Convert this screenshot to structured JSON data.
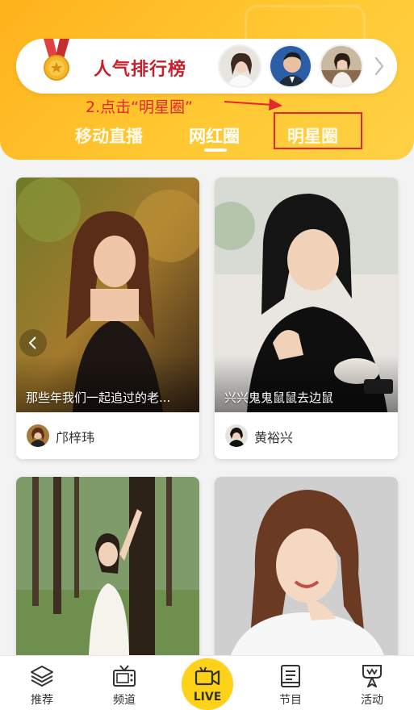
{
  "ranking": {
    "title": "人气排行榜",
    "medal_icon": "medal-icon",
    "more_icon": "chevron-right-icon"
  },
  "annotation": {
    "text": "2.点击“明星圈”",
    "color": "#e5262d"
  },
  "tabs": [
    {
      "label": "移动直播",
      "active": false
    },
    {
      "label": "网红圈",
      "active": true
    },
    {
      "label": "明星圈",
      "active": false
    }
  ],
  "cards": [
    {
      "caption": "那些年我们一起追过的老...",
      "author": "邝梓玮"
    },
    {
      "caption": "兴兴鬼鬼鼠鼠去边鼠",
      "author": "黄裕兴"
    },
    {
      "caption": "",
      "author": ""
    },
    {
      "caption": "",
      "author": ""
    }
  ],
  "bottom_nav": [
    {
      "label": "推荐",
      "icon": "layers-icon"
    },
    {
      "label": "频道",
      "icon": "tv-icon"
    },
    {
      "label": "LIVE",
      "icon": "video-camera-icon"
    },
    {
      "label": "节目",
      "icon": "document-icon"
    },
    {
      "label": "活动",
      "icon": "ribbon-icon"
    }
  ],
  "colors": {
    "header_gradient_start": "#ffb21c",
    "header_gradient_end": "#ffd146",
    "rank_title": "#c8202b",
    "live_button": "#ffd21a"
  }
}
